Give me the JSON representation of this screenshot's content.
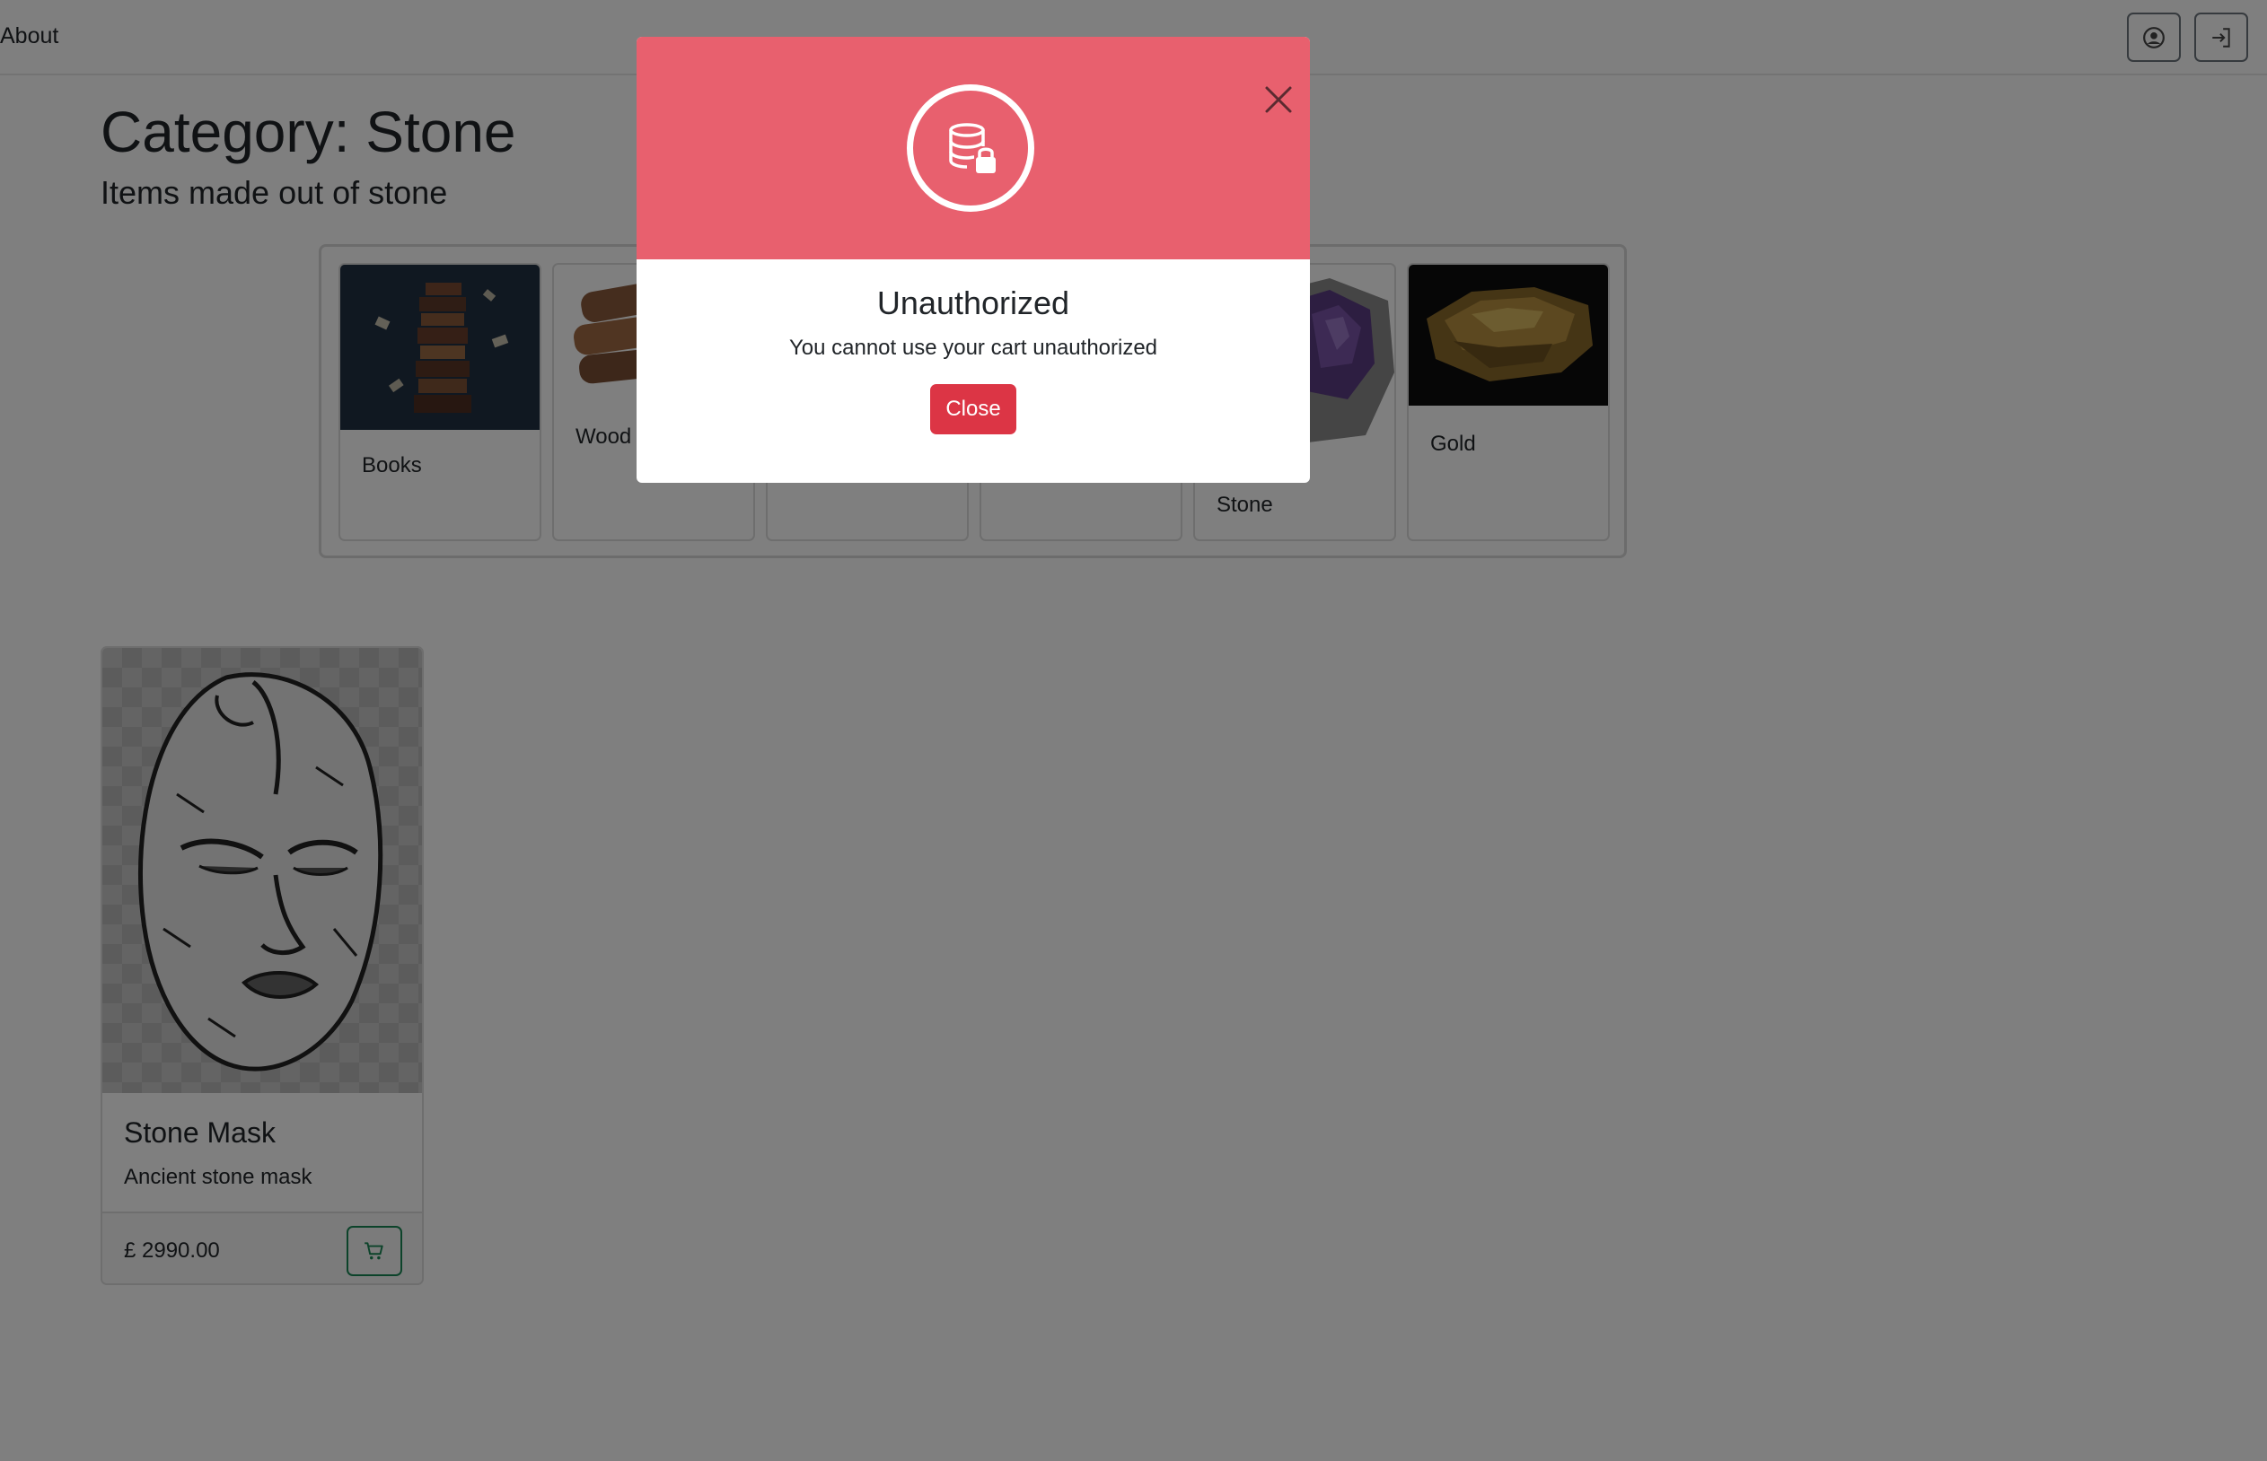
{
  "nav": {
    "about_label": "About",
    "profile_icon": "user-circle-icon",
    "login_icon": "sign-in-icon"
  },
  "header": {
    "title": "Category: Stone",
    "subtitle": "Items made out of stone"
  },
  "categories": [
    {
      "label": "Books",
      "image": "books-image"
    },
    {
      "label": "Wood",
      "image": "wood-image"
    },
    {
      "label": "",
      "image": ""
    },
    {
      "label": "",
      "image": ""
    },
    {
      "label": "Stone",
      "image": "amethyst-stone-image"
    },
    {
      "label": "Gold",
      "image": "gold-nugget-image"
    }
  ],
  "product": {
    "title": "Stone Mask",
    "description": "Ancient stone mask",
    "price": "£ 2990.00",
    "cart_icon": "cart-icon"
  },
  "modal": {
    "icon": "database-lock-icon",
    "title": "Unauthorized",
    "message": "You cannot use your cart unauthorized",
    "close_label": "Close"
  },
  "colors": {
    "modal_header": "#e8606e",
    "danger_button": "#dc3545",
    "success_outline": "#198754",
    "backdrop": "rgba(0,0,0,0.5)"
  }
}
